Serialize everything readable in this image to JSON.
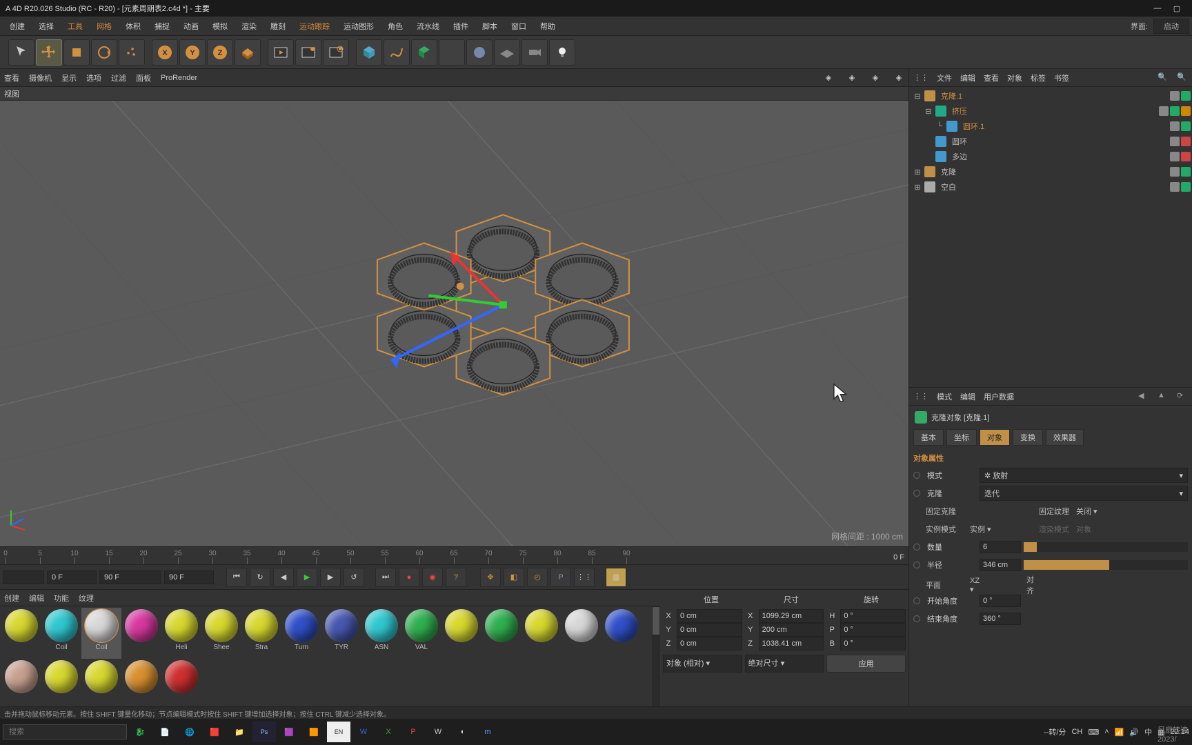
{
  "title": "A 4D R20.026 Studio (RC - R20) - [元素周期表2.c4d *] - 主要",
  "menubar": [
    "创建",
    "选择",
    "工具",
    "网格",
    "体积",
    "捕捉",
    "动画",
    "模拟",
    "渲染",
    "雕刻",
    "运动跟踪",
    "运动图形",
    "角色",
    "流水线",
    "插件",
    "脚本",
    "窗口",
    "帮助"
  ],
  "menubar_orange": [
    2,
    3,
    10
  ],
  "layout_label": "界面:",
  "layout_value": "启动",
  "vpmenu": [
    "查看",
    "摄像机",
    "显示",
    "选项",
    "过滤",
    "面板",
    "ProRender"
  ],
  "vplabel": "视图",
  "gridinfo": "网格间距 : 1000 cm",
  "timeline": {
    "start": 0,
    "end": 90,
    "step": 5,
    "cur": "0 F"
  },
  "timefields": [
    "0 F",
    "90 F",
    "90 F"
  ],
  "matmenu": [
    "创建",
    "编辑",
    "功能",
    "纹理"
  ],
  "materials_row1": [
    {
      "name": "",
      "color": "#d8d830"
    },
    {
      "name": "Coil",
      "color": "#30c8d0"
    },
    {
      "name": "Coil",
      "color": "#d8d8d8",
      "sel": true
    },
    {
      "name": "",
      "color": "#d838a0"
    },
    {
      "name": "Heli",
      "color": "#d8d830"
    },
    {
      "name": "Shee",
      "color": "#d8d830"
    },
    {
      "name": "Stra",
      "color": "#d8d830"
    },
    {
      "name": "Turn",
      "color": "#3050c8"
    },
    {
      "name": "TYR",
      "color": "#4858b0"
    },
    {
      "name": "ASN",
      "color": "#30c8d0"
    },
    {
      "name": "VAL",
      "color": "#30b050"
    }
  ],
  "materials_row2": [
    {
      "color": "#d8d830"
    },
    {
      "color": "#30b050"
    },
    {
      "color": "#d8d830"
    },
    {
      "color": "#d8d8d8"
    },
    {
      "color": "#3050c8"
    },
    {
      "color": "#c8a090"
    },
    {
      "color": "#d8d830"
    },
    {
      "color": "#d8d830"
    },
    {
      "color": "#d89030"
    },
    {
      "color": "#d03030"
    }
  ],
  "coords": {
    "headers": [
      "位置",
      "尺寸",
      "旋转"
    ],
    "rows": [
      {
        "a": "X",
        "av": "0 cm",
        "b": "X",
        "bv": "1099.29 cm",
        "c": "H",
        "cv": "0 °"
      },
      {
        "a": "Y",
        "av": "0 cm",
        "b": "Y",
        "bv": "200 cm",
        "c": "P",
        "cv": "0 °"
      },
      {
        "a": "Z",
        "av": "0 cm",
        "b": "Z",
        "bv": "1038.41 cm",
        "c": "B",
        "cv": "0 °"
      }
    ],
    "dd1": "对象 (相对)",
    "dd2": "绝对尺寸",
    "apply": "应用"
  },
  "objmenu": [
    "文件",
    "编辑",
    "查看",
    "对象",
    "标签",
    "书签"
  ],
  "objtree": [
    {
      "ind": 0,
      "exp": "⊟",
      "icon": "#c09048",
      "name": "克隆.1",
      "sel": true,
      "flags": [
        "#888",
        "#2a6"
      ]
    },
    {
      "ind": 1,
      "exp": "⊟",
      "icon": "#2a8",
      "name": "挤压",
      "sel": true,
      "flags": [
        "#888",
        "#2a6",
        "#c80"
      ]
    },
    {
      "ind": 2,
      "exp": "└",
      "icon": "#49c",
      "name": "圆环.1",
      "sel": true,
      "flags": [
        "#888",
        "#2a6"
      ]
    },
    {
      "ind": 1,
      "exp": "",
      "icon": "#49c",
      "name": "圆环",
      "sel": false,
      "flags": [
        "#888",
        "#c44"
      ]
    },
    {
      "ind": 1,
      "exp": "",
      "icon": "#49c",
      "name": "多边",
      "sel": false,
      "flags": [
        "#888",
        "#c44"
      ]
    },
    {
      "ind": 0,
      "exp": "⊞",
      "icon": "#c09048",
      "name": "克隆",
      "sel": false,
      "flags": [
        "#888",
        "#2a6"
      ]
    },
    {
      "ind": 0,
      "exp": "⊞",
      "icon": "#aaa",
      "name": "空白",
      "sel": false,
      "flags": [
        "#888",
        "#2a6"
      ]
    }
  ],
  "attmenu": [
    "模式",
    "编辑",
    "用户数据"
  ],
  "att_title": "克隆对象 [克隆.1]",
  "att_tabs": [
    "基本",
    "坐标",
    "对象",
    "变换",
    "效果器"
  ],
  "att_active_tab": 2,
  "att_section": "对象属性",
  "props": {
    "mode_label": "模式",
    "mode_val": "放射",
    "clone_label": "克隆",
    "clone_val": "迭代",
    "fixc_label": "固定克隆",
    "fixt_label": "固定纹理",
    "fixt_val": "关闭",
    "inst_label": "实例模式",
    "inst_val": "实例",
    "rm_label": "渲染模式",
    "rm_val": "对象",
    "count_label": "数量",
    "count_val": "6",
    "radius_label": "半径",
    "radius_val": "346 cm",
    "plane_label": "平面",
    "plane_val": "XZ",
    "align_label": "对齐",
    "start_label": "开始角度",
    "start_val": "0 °",
    "end_label": "结束角度",
    "end_val": "360 °"
  },
  "hint": "击并拖动鼠标移动元素。按住 SHIFT 键量化移动；节点编辑模式时按住 SHIFT 键增加选择对象；按住 CTRL 键减少选择对象。",
  "taskbar": {
    "search": "搜索",
    "rpm": "--转/分",
    "fan": "风扇转速",
    "lang": "CH",
    "ime": "中",
    "time": "22:14",
    "date": "2023/"
  }
}
